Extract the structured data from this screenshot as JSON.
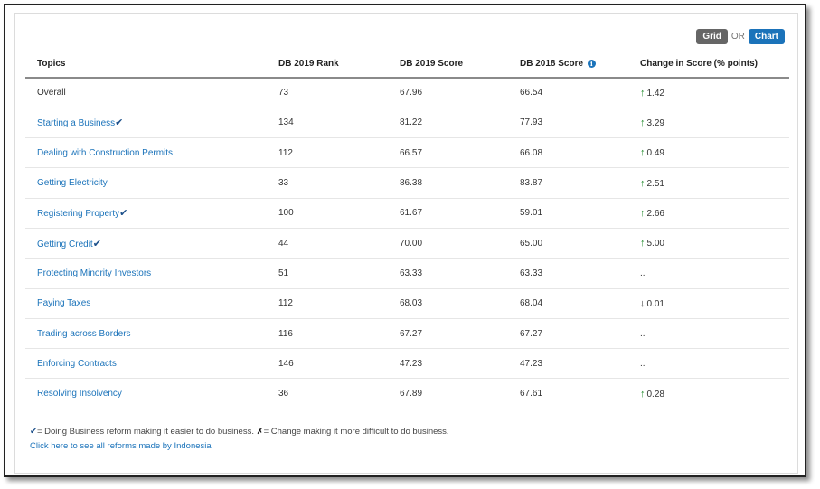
{
  "toggle": {
    "grid_label": "Grid",
    "or_label": "OR",
    "chart_label": "Chart"
  },
  "table": {
    "headers": {
      "topics": "Topics",
      "rank2019": "DB 2019 Rank",
      "score2019": "DB 2019 Score",
      "score2018": "DB 2018 Score",
      "change": "Change in Score (% points)"
    },
    "rows": [
      {
        "topic": "Overall",
        "reform": "",
        "rank": "73",
        "score2019": "67.96",
        "score2018": "66.54",
        "direction": "up",
        "change": "1.42"
      },
      {
        "topic": "Starting a Business",
        "reform": "✔",
        "rank": "134",
        "score2019": "81.22",
        "score2018": "77.93",
        "direction": "up",
        "change": "3.29"
      },
      {
        "topic": "Dealing with Construction Permits",
        "reform": "",
        "rank": "112",
        "score2019": "66.57",
        "score2018": "66.08",
        "direction": "up",
        "change": "0.49"
      },
      {
        "topic": "Getting Electricity",
        "reform": "",
        "rank": "33",
        "score2019": "86.38",
        "score2018": "83.87",
        "direction": "up",
        "change": "2.51"
      },
      {
        "topic": "Registering Property",
        "reform": "✔",
        "rank": "100",
        "score2019": "61.67",
        "score2018": "59.01",
        "direction": "up",
        "change": "2.66"
      },
      {
        "topic": "Getting Credit",
        "reform": "✔",
        "rank": "44",
        "score2019": "70.00",
        "score2018": "65.00",
        "direction": "up",
        "change": "5.00"
      },
      {
        "topic": "Protecting Minority Investors",
        "reform": "",
        "rank": "51",
        "score2019": "63.33",
        "score2018": "63.33",
        "direction": "none",
        "change": ".."
      },
      {
        "topic": "Paying Taxes",
        "reform": "",
        "rank": "112",
        "score2019": "68.03",
        "score2018": "68.04",
        "direction": "down",
        "change": "0.01"
      },
      {
        "topic": "Trading across Borders",
        "reform": "",
        "rank": "116",
        "score2019": "67.27",
        "score2018": "67.27",
        "direction": "none",
        "change": ".."
      },
      {
        "topic": "Enforcing Contracts",
        "reform": "",
        "rank": "146",
        "score2019": "47.23",
        "score2018": "47.23",
        "direction": "none",
        "change": ".."
      },
      {
        "topic": "Resolving Insolvency",
        "reform": "",
        "rank": "36",
        "score2019": "67.89",
        "score2018": "67.61",
        "direction": "up",
        "change": "0.28"
      }
    ]
  },
  "legend": {
    "check_symbol": "✔",
    "check_text": "= Doing Business reform making it easier to do business.",
    "x_symbol": "✗",
    "x_text": "=  Change making it more difficult to do business."
  },
  "reform_link": "Click here to see all reforms made by Indonesia",
  "icons": {
    "up": "arrow-up-icon",
    "down": "arrow-down-icon",
    "info": "info-icon"
  },
  "colors": {
    "link": "#1b73ba",
    "up_arrow": "#1f8a2a",
    "grid_button": "#666666",
    "chart_button": "#1b73ba"
  }
}
